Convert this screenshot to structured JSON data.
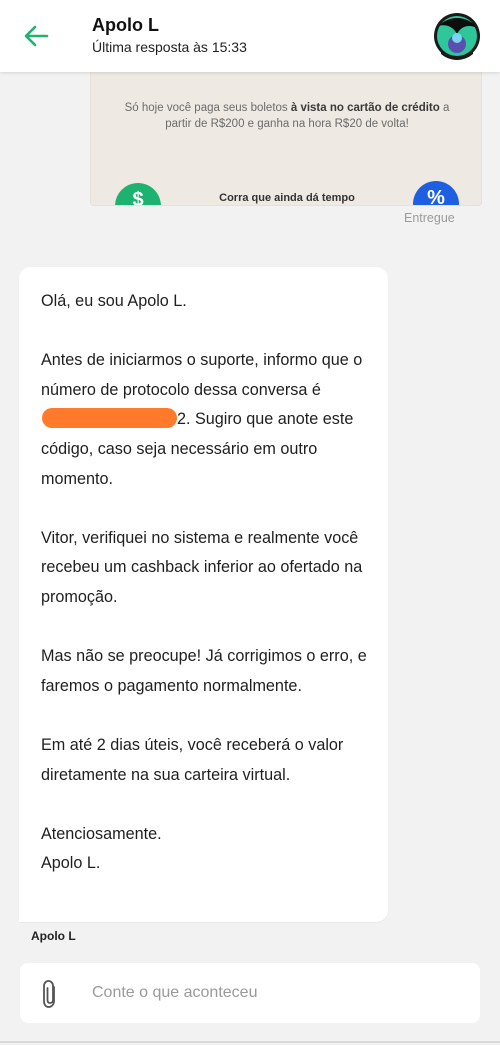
{
  "header": {
    "back_icon": "arrow-left-icon",
    "agent_name": "Apolo L",
    "last_reply": "Última resposta às 15:33",
    "avatar_icon": "agent-avatar"
  },
  "banner": {
    "text_lead": "Só hoje você paga seus boletos ",
    "text_bold": "à vista no cartão de crédito",
    "text_tail": " a partir de R$200 e ganha na hora R$20 de volta!",
    "cta": "Corra que ainda dá tempo",
    "left_icon": "dollar-icon",
    "left_glyph": "$",
    "right_icon": "percent-icon",
    "right_glyph": "%",
    "status": "Entregue"
  },
  "message": {
    "greeting": "Olá, eu sou Apolo L.",
    "protocol_before": "Antes de iniciarmos o suporte, informo que o número de protocolo dessa conversa é ",
    "protocol_after": "2. Sugiro que anote este código, caso seja necessário em outro momento.",
    "paragraph_3": "Vitor, verifiquei no sistema e realmente você recebeu um cashback inferior ao ofertado na promoção.",
    "paragraph_4": "Mas não se preocupe! Já corrigimos o erro, e faremos o pagamento normalmente.",
    "paragraph_5": "Em até 2 dias úteis, você receberá o valor diretamente na sua carteira virtual.",
    "signoff": "Atenciosamente.",
    "signature": "Apolo L.",
    "sender_label": "Apolo L"
  },
  "composer": {
    "attach_icon": "paperclip-icon",
    "placeholder": "Conte o que aconteceu",
    "value": ""
  },
  "colors": {
    "accent": "#1eb270",
    "redaction": "#ff7a2a",
    "background": "#f2f2f2"
  }
}
